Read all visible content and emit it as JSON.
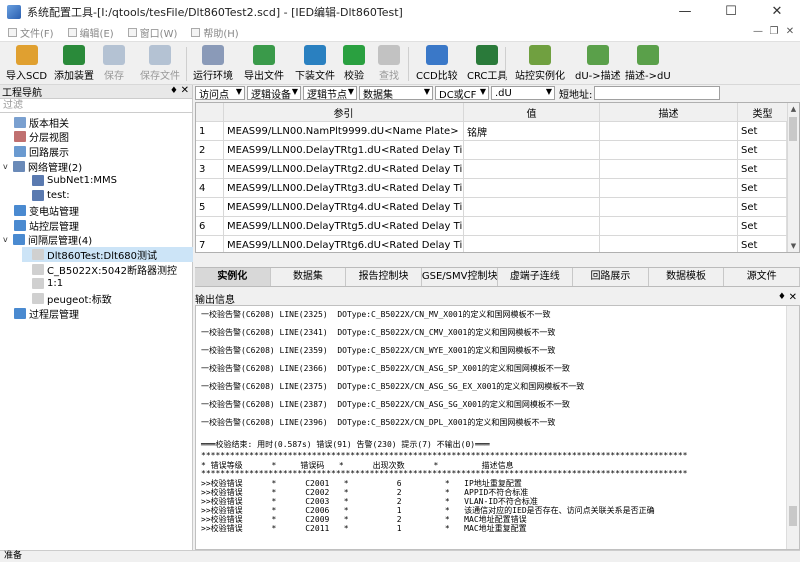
{
  "window": {
    "title": "系统配置工具-[I:/qtools/tesFile/Dlt860Test2.scd] - [IED编辑-Dlt860Test]",
    "minimize": "—",
    "maximize": "☐",
    "close": "✕"
  },
  "menu": {
    "items": [
      "文件(F)",
      "编辑(E)",
      "窗口(W)",
      "帮助(H)"
    ],
    "mdi_min": "—",
    "mdi_restore": "❐",
    "mdi_close": "✕"
  },
  "toolbar": {
    "items": [
      {
        "label": "导入SCD",
        "icon": "folder-icon",
        "color": "#e0a030"
      },
      {
        "label": "添加装置",
        "icon": "add-device-icon",
        "color": "#2a8a3a"
      },
      {
        "label": "保存",
        "icon": "save-icon",
        "color": "#6a8ab0"
      },
      {
        "label": "保存文件",
        "icon": "save-file-icon",
        "color": "#6a8ab0"
      },
      {
        "label": "运行环境",
        "icon": "printer-icon",
        "color": "#8a9ab8"
      },
      {
        "label": "导出文件",
        "icon": "export-icon",
        "color": "#3a9a4a"
      },
      {
        "label": "下装文件",
        "icon": "download-icon",
        "color": "#2a80c0"
      },
      {
        "label": "校验",
        "icon": "check-icon",
        "color": "#2aa040"
      },
      {
        "label": "查找",
        "icon": "magnifier-icon",
        "color": "#8a8a8a"
      },
      {
        "label": "CCD比较",
        "icon": "ccd-compare-icon",
        "color": "#3a78c8"
      },
      {
        "label": "CRC工具",
        "icon": "crc-icon",
        "color": "#2a7a3a"
      },
      {
        "label": "站控实例化",
        "icon": "wand-icon",
        "color": "#70a040"
      },
      {
        "label": "dU->描述",
        "icon": "du-to-desc-icon",
        "color": "#5aa04a"
      },
      {
        "label": "描述->dU",
        "icon": "desc-to-du-icon",
        "color": "#5aa04a"
      }
    ]
  },
  "nav": {
    "title": "工程导航",
    "pin": "♦",
    "close": "✕",
    "filter_placeholder": "过滤",
    "tree": [
      {
        "label": "版本相关",
        "toggle": "",
        "icon_color": "#7aa0d0"
      },
      {
        "label": "分层视图",
        "toggle": "",
        "icon_color": "#c07070"
      },
      {
        "label": "回路展示",
        "toggle": "",
        "icon_color": "#6a9ad0"
      },
      {
        "label": "网络管理(2)",
        "toggle": "v",
        "icon_color": "#6a8ab8"
      },
      {
        "label": "SubNet1:MMS",
        "toggle": "",
        "icon_color": "#5a7ab0"
      },
      {
        "label": "test:",
        "toggle": "",
        "icon_color": "#5a7ab0"
      },
      {
        "label": "变电站管理",
        "toggle": "",
        "icon_color": "#4a8ad0"
      },
      {
        "label": "站控层管理",
        "toggle": "",
        "icon_color": "#4a8ad0"
      },
      {
        "label": "间隔层管理(4)",
        "toggle": "v",
        "icon_color": "#4a8ad0"
      },
      {
        "label": "Dlt860Test:Dlt680测试",
        "toggle": "",
        "icon_color": "#d0d0d0"
      },
      {
        "label": "C_B5022X:5042断路器测控",
        "toggle": "",
        "icon_color": "#d0d0d0"
      },
      {
        "label": "1:1",
        "toggle": "",
        "icon_color": "#d0d0d0"
      },
      {
        "label": "peugeot:标致",
        "toggle": "",
        "icon_color": "#d0d0d0"
      },
      {
        "label": "过程层管理",
        "toggle": "",
        "icon_color": "#4a8ad0"
      }
    ]
  },
  "filters": {
    "access_point": "访问点",
    "logical_device": "逻辑设备",
    "logical_node": "逻辑节点",
    "dataset": "数据集",
    "fc": "DC或CF",
    "suffix": ".dU",
    "short_addr_label": "短地址:",
    "arrow": "▼"
  },
  "grid": {
    "headers": [
      "",
      "参引",
      "值",
      "描述",
      "类型"
    ],
    "rows": [
      {
        "num": "1",
        "ref": "MEAS99/LLN00.NamPlt9999.dU<Name Plate>",
        "value": "铭牌",
        "desc": "",
        "type": "Set"
      },
      {
        "num": "2",
        "ref": "MEAS99/LLN00.DelayTRtg1.dU<Rated Delay Time 1>",
        "value": "",
        "desc": "",
        "type": "Set"
      },
      {
        "num": "3",
        "ref": "MEAS99/LLN00.DelayTRtg2.dU<Rated Delay Time 2>",
        "value": "",
        "desc": "",
        "type": "Set"
      },
      {
        "num": "4",
        "ref": "MEAS99/LLN00.DelayTRtg3.dU<Rated Delay Time 3>",
        "value": "",
        "desc": "",
        "type": "Set"
      },
      {
        "num": "5",
        "ref": "MEAS99/LLN00.DelayTRtg4.dU<Rated Delay Time 4>",
        "value": "",
        "desc": "",
        "type": "Set"
      },
      {
        "num": "6",
        "ref": "MEAS99/LLN00.DelayTRtg5.dU<Rated Delay Time 5>",
        "value": "",
        "desc": "",
        "type": "Set"
      },
      {
        "num": "7",
        "ref": "MEAS99/LLN00.DelayTRtg6.dU<Rated Delay Time 6>",
        "value": "",
        "desc": "",
        "type": "Set"
      }
    ]
  },
  "tabs": [
    "实例化",
    "数据集",
    "报告控制块",
    "GSE/SMV控制块",
    "虚端子连线",
    "回路展示",
    "数据模板",
    "源文件"
  ],
  "output": {
    "title": "输出信息",
    "pin": "♦",
    "close": "✕",
    "lines": [
      "一校验告警(C6208) LINE(2325)  DOType:C_B5022X/CN_MV_X001的定义和国网模板不一致",
      "一校验告警(C6208) LINE(2341)  DOType:C_B5022X/CN_CMV_X001的定义和国网模板不一致",
      "一校验告警(C6208) LINE(2359)  DOType:C_B5022X/CN_WYE_X001的定义和国网模板不一致",
      "一校验告警(C6208) LINE(2366)  DOType:C_B5022X/CN_ASG_SP_X001的定义和国网模板不一致",
      "一校验告警(C6208) LINE(2375)  DOType:C_B5022X/CN_ASG_SG_EX_X001的定义和国网模板不一致",
      "一校验告警(C6208) LINE(2387)  DOType:C_B5022X/CN_ASG_SG_X001的定义和国网模板不一致",
      "一校验告警(C6208) LINE(2396)  DOType:C_B5022X/CN_DPL_X001的定义和国网模板不一致",
      "═══校验结束: 用时(0.587s) 错误(91) 告警(230) 提示(7) 不输出(0)═══",
      "*****************************************************************************************************",
      "* 错误等级      *     错误码   *      出现次数      *         描述信息",
      "*****************************************************************************************************",
      ">>校验错误      *      C2001   *          6         *   IP地址重复配置",
      ">>校验错误      *      C2002   *          2         *   APPID不符合标准",
      ">>校验错误      *      C2003   *          2         *   VLAN-ID不符合标准",
      ">>校验错误      *      C2006   *          1         *   该通信对应的IED是否存在、访问点关联关系是否正确",
      ">>校验错误      *      C2009   *          2         *   MAC地址配置错误",
      ">>校验错误      *      C2011   *          1         *   MAC地址重复配置"
    ]
  },
  "status": {
    "text": "准备"
  }
}
